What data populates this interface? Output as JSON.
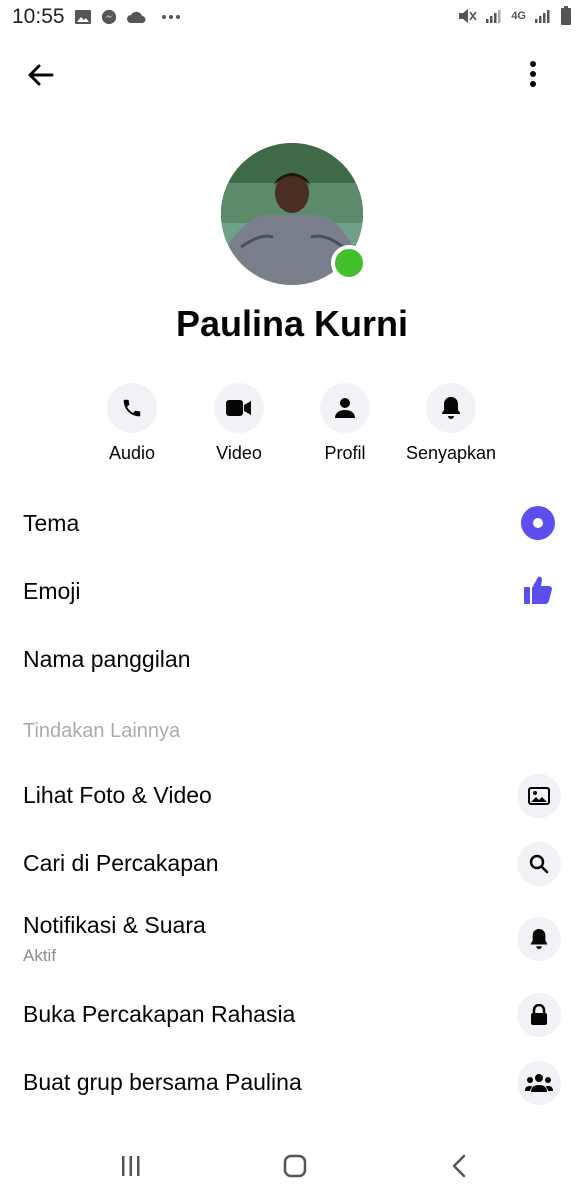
{
  "status_bar": {
    "time": "10:55",
    "network": "4G",
    "icons": [
      "gallery-icon",
      "messenger-icon",
      "cloud-icon",
      "more-dots-icon",
      "mute-icon",
      "signal-icon",
      "4g-signal-icon",
      "battery-icon"
    ]
  },
  "header": {
    "back_icon": "arrow-left-icon",
    "menu_icon": "more-vertical-icon"
  },
  "profile": {
    "name": "Paulina Kurni",
    "online": true,
    "online_color": "#42c02c"
  },
  "quick_actions": [
    {
      "label": "Audio",
      "icon": "phone-icon"
    },
    {
      "label": "Video",
      "icon": "video-camera-icon"
    },
    {
      "label": "Profil",
      "icon": "person-icon"
    },
    {
      "label": "Senyapkan",
      "icon": "bell-icon"
    }
  ],
  "settings": [
    {
      "label": "Tema",
      "icon": "theme-dot-icon"
    },
    {
      "label": "Emoji",
      "icon": "thumbs-up-icon"
    },
    {
      "label": "Nama panggilan"
    }
  ],
  "more_actions": {
    "title": "Tindakan Lainnya",
    "items": [
      {
        "label": "Lihat Foto & Video",
        "icon": "photo-icon"
      },
      {
        "label": "Cari di Percakapan",
        "icon": "search-icon"
      },
      {
        "label": "Notifikasi & Suara",
        "sublabel": "Aktif",
        "icon": "bell-icon"
      },
      {
        "label": "Buka Percakapan Rahasia",
        "icon": "lock-icon"
      },
      {
        "label": "Buat grup bersama Paulina",
        "icon": "group-icon"
      }
    ]
  },
  "colors": {
    "accent": "#5b4ff0",
    "icon_bg": "#f0f2f5",
    "secondary_text": "#8a8d91"
  },
  "nav_bar": {
    "icons": [
      "recent-apps-icon",
      "home-icon",
      "back-nav-icon"
    ]
  }
}
